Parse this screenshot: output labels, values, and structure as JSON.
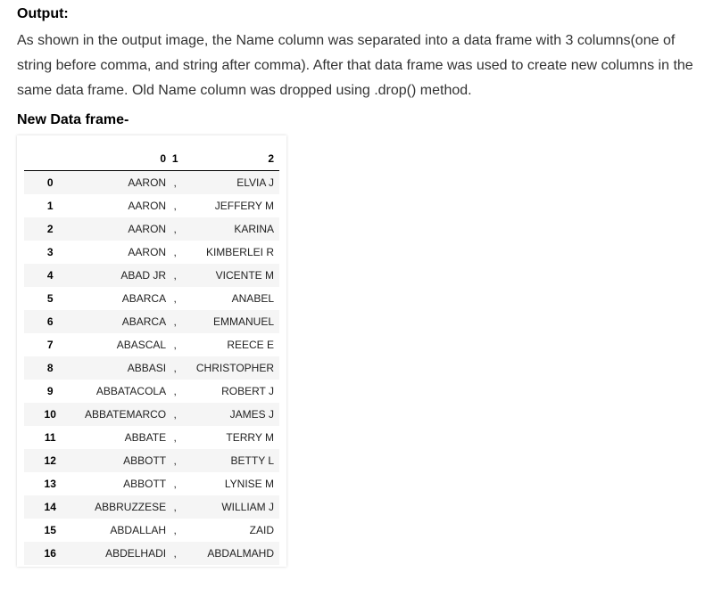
{
  "output": {
    "heading": "Output:",
    "paragraph": "As shown in the output image, the Name column was separated into a data frame with 3 columns(one of string before comma, and string after comma). After that data frame was used to create new columns in the same data frame. Old Name column was dropped using .drop() method.",
    "subheading": "New Data frame-"
  },
  "dataframe": {
    "columns": [
      "",
      "0",
      "1",
      "2"
    ],
    "rows": [
      {
        "index": "0",
        "c0": "AARON",
        "c1": ",",
        "c2": "ELVIA J"
      },
      {
        "index": "1",
        "c0": "AARON",
        "c1": ",",
        "c2": "JEFFERY M"
      },
      {
        "index": "2",
        "c0": "AARON",
        "c1": ",",
        "c2": "KARINA"
      },
      {
        "index": "3",
        "c0": "AARON",
        "c1": ",",
        "c2": "KIMBERLEI R"
      },
      {
        "index": "4",
        "c0": "ABAD JR",
        "c1": ",",
        "c2": "VICENTE M"
      },
      {
        "index": "5",
        "c0": "ABARCA",
        "c1": ",",
        "c2": "ANABEL"
      },
      {
        "index": "6",
        "c0": "ABARCA",
        "c1": ",",
        "c2": "EMMANUEL"
      },
      {
        "index": "7",
        "c0": "ABASCAL",
        "c1": ",",
        "c2": "REECE E"
      },
      {
        "index": "8",
        "c0": "ABBASI",
        "c1": ",",
        "c2": "CHRISTOPHER"
      },
      {
        "index": "9",
        "c0": "ABBATACOLA",
        "c1": ",",
        "c2": "ROBERT J"
      },
      {
        "index": "10",
        "c0": "ABBATEMARCO",
        "c1": ",",
        "c2": "JAMES J"
      },
      {
        "index": "11",
        "c0": "ABBATE",
        "c1": ",",
        "c2": "TERRY M"
      },
      {
        "index": "12",
        "c0": "ABBOTT",
        "c1": ",",
        "c2": "BETTY L"
      },
      {
        "index": "13",
        "c0": "ABBOTT",
        "c1": ",",
        "c2": "LYNISE M"
      },
      {
        "index": "14",
        "c0": "ABBRUZZESE",
        "c1": ",",
        "c2": "WILLIAM J"
      },
      {
        "index": "15",
        "c0": "ABDALLAH",
        "c1": ",",
        "c2": "ZAID"
      },
      {
        "index": "16",
        "c0": "ABDELHADI",
        "c1": ",",
        "c2": "ABDALMAHD"
      }
    ]
  }
}
